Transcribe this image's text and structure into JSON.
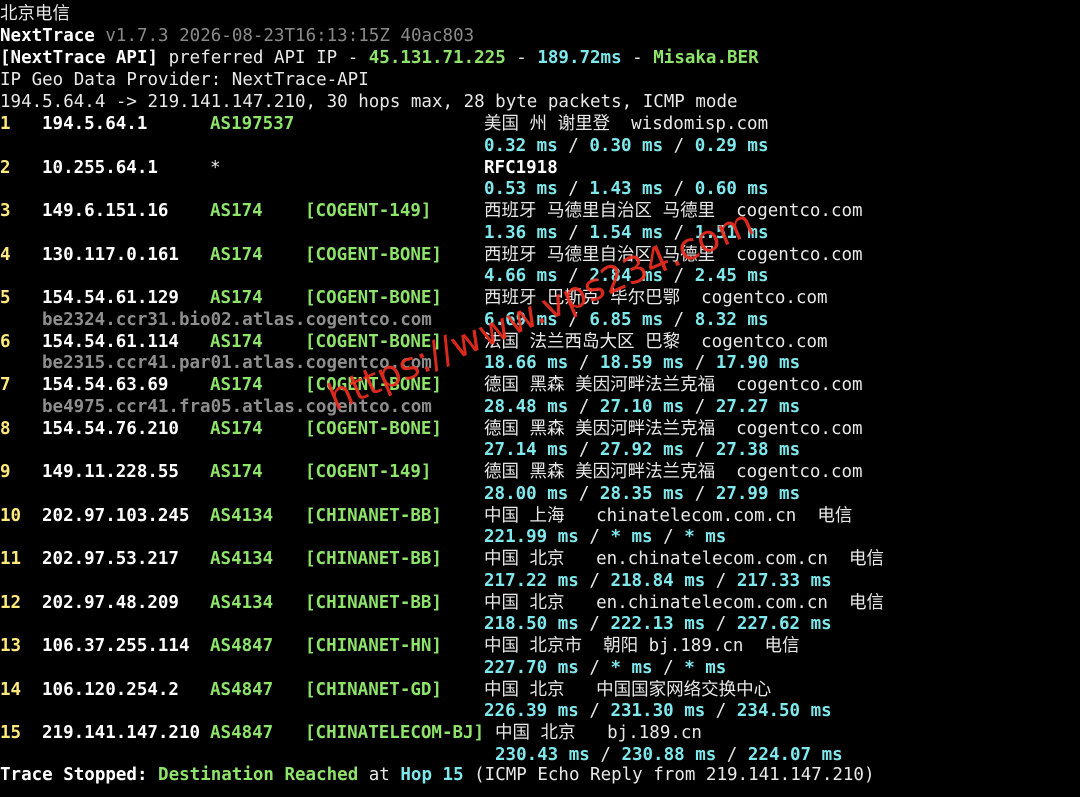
{
  "window": {
    "title": "北京电信"
  },
  "header": {
    "app_name": "NextTrace",
    "version": "v1.7.3",
    "build_time": "2026-08-23T16:13:15Z",
    "commit": "40ac803",
    "api_tag": "[NextTrace API]",
    "api_text": " preferred API IP - ",
    "api_ip": "45.131.71.225",
    "sep1": " - ",
    "api_latency": "189.72ms",
    "sep2": " - ",
    "api_node": "Misaka.BER",
    "geo_provider": "IP Geo Data Provider: NextTrace-API",
    "trace_summary": "194.5.64.4 -> 219.141.147.210, 30 hops max, 28 byte packets, ICMP mode"
  },
  "hops": [
    {
      "hop": "1",
      "ip": "194.5.64.1",
      "asn": "AS197537",
      "tag": "",
      "geo": "美国 州 谢里登  wisdomisp.com",
      "rtt": [
        "0.32",
        "0.30",
        "0.29"
      ],
      "hostname": ""
    },
    {
      "hop": "2",
      "ip": "10.255.64.1",
      "asn": "*",
      "tag": "",
      "geo": "RFC1918",
      "rtt": [
        "0.53",
        "1.43",
        "0.60"
      ],
      "hostname": ""
    },
    {
      "hop": "3",
      "ip": "149.6.151.16",
      "asn": "AS174",
      "tag": "[COGENT-149]",
      "geo": "西班牙 马德里自治区 马德里  cogentco.com",
      "rtt": [
        "1.36",
        "1.54",
        "1.51"
      ],
      "hostname": ""
    },
    {
      "hop": "4",
      "ip": "130.117.0.161",
      "asn": "AS174",
      "tag": "[COGENT-BONE]",
      "geo": "西班牙 马德里自治区 马德里  cogentco.com",
      "rtt": [
        "4.66",
        "2.84",
        "2.45"
      ],
      "hostname": ""
    },
    {
      "hop": "5",
      "ip": "154.54.61.129",
      "asn": "AS174",
      "tag": "[COGENT-BONE]",
      "geo": "西班牙 巴斯克 毕尔巴鄂  cogentco.com",
      "rtt": [
        "6.69",
        "6.85",
        "8.32"
      ],
      "hostname": "be2324.ccr31.bio02.atlas.cogentco.com"
    },
    {
      "hop": "6",
      "ip": "154.54.61.114",
      "asn": "AS174",
      "tag": "[COGENT-BONE]",
      "geo": "法国 法兰西岛大区 巴黎  cogentco.com",
      "rtt": [
        "18.66",
        "18.59",
        "17.90"
      ],
      "hostname": "be2315.ccr41.par01.atlas.cogentco.com"
    },
    {
      "hop": "7",
      "ip": "154.54.63.69",
      "asn": "AS174",
      "tag": "[COGENT-BONE]",
      "geo": "德国 黑森 美因河畔法兰克福  cogentco.com",
      "rtt": [
        "28.48",
        "27.10",
        "27.27"
      ],
      "hostname": "be4975.ccr41.fra05.atlas.cogentco.com"
    },
    {
      "hop": "8",
      "ip": "154.54.76.210",
      "asn": "AS174",
      "tag": "[COGENT-BONE]",
      "geo": "德国 黑森 美因河畔法兰克福  cogentco.com",
      "rtt": [
        "27.14",
        "27.92",
        "27.38"
      ],
      "hostname": ""
    },
    {
      "hop": "9",
      "ip": "149.11.228.55",
      "asn": "AS174",
      "tag": "[COGENT-149]",
      "geo": "德国 黑森 美因河畔法兰克福  cogentco.com",
      "rtt": [
        "28.00",
        "28.35",
        "27.99"
      ],
      "hostname": ""
    },
    {
      "hop": "10",
      "ip": "202.97.103.245",
      "asn": "AS4134",
      "tag": "[CHINANET-BB]",
      "geo": "中国 上海   chinatelecom.com.cn  电信",
      "rtt": [
        "221.99",
        "*",
        "*"
      ],
      "hostname": ""
    },
    {
      "hop": "11",
      "ip": "202.97.53.217",
      "asn": "AS4134",
      "tag": "[CHINANET-BB]",
      "geo": "中国 北京   en.chinatelecom.com.cn  电信",
      "rtt": [
        "217.22",
        "218.84",
        "217.33"
      ],
      "hostname": ""
    },
    {
      "hop": "12",
      "ip": "202.97.48.209",
      "asn": "AS4134",
      "tag": "[CHINANET-BB]",
      "geo": "中国 北京   en.chinatelecom.com.cn  电信",
      "rtt": [
        "218.50",
        "222.13",
        "227.62"
      ],
      "hostname": ""
    },
    {
      "hop": "13",
      "ip": "106.37.255.114",
      "asn": "AS4847",
      "tag": "[CHINANET-HN]",
      "geo": "中国 北京市  朝阳 bj.189.cn  电信",
      "rtt": [
        "227.70",
        "*",
        "*"
      ],
      "hostname": ""
    },
    {
      "hop": "14",
      "ip": "106.120.254.2",
      "asn": "AS4847",
      "tag": "[CHINANET-GD]",
      "geo": "中国 北京   中国国家网络交换中心",
      "rtt": [
        "226.39",
        "231.30",
        "234.50"
      ],
      "hostname": ""
    },
    {
      "hop": "15",
      "ip": "219.141.147.210",
      "asn": "AS4847",
      "tag": "[CHINATELECOM-BJ]",
      "geo": "中国 北京   bj.189.cn",
      "rtt": [
        "230.43",
        "230.88",
        "224.07"
      ],
      "hostname": ""
    }
  ],
  "rtt_unit": "ms",
  "rtt_sep": " / ",
  "footer": {
    "p1": "Trace Stopped: ",
    "p2": "Destination Reached",
    "p3": " at ",
    "p4": "Hop 15",
    "p5": " (ICMP Echo Reply from 219.141.147.210)"
  },
  "watermark": "https://www.vps234.com",
  "colors": {
    "background": "#000000",
    "bold_white": "#ffffff",
    "hop_number": "#ffe97a",
    "asn_tag": "#8ee36a",
    "latency": "#7fe8ec",
    "version_dim": "#8a8a8a",
    "hostname": "#8e8e8e",
    "watermark": "#eb2d1e"
  }
}
